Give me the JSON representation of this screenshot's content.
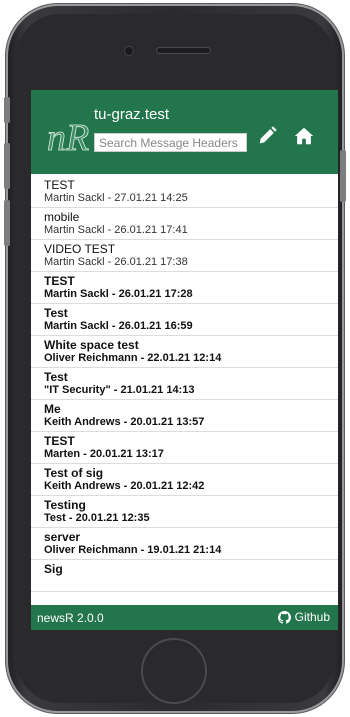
{
  "header": {
    "logo_text": "nR",
    "title": "tu-graz.test",
    "search_placeholder": "Search Message Headers",
    "edit_icon": "pencil-icon",
    "home_icon": "home-icon"
  },
  "messages": [
    {
      "subject": "TEST",
      "meta": "Martin Sackl - 27.01.21 14:25",
      "unread": false
    },
    {
      "subject": "mobile",
      "meta": "Martin Sackl - 26.01.21 17:41",
      "unread": false
    },
    {
      "subject": "VIDEO TEST",
      "meta": "Martin Sackl - 26.01.21 17:38",
      "unread": false
    },
    {
      "subject": "TEST",
      "meta": "Martin Sackl - 26.01.21 17:28",
      "unread": true
    },
    {
      "subject": "Test",
      "meta": "Martin Sackl - 26.01.21 16:59",
      "unread": true
    },
    {
      "subject": "White space test",
      "meta": "Oliver Reichmann - 22.01.21 12:14",
      "unread": true
    },
    {
      "subject": "Test",
      "meta": "\"IT Security\" - 21.01.21 14:13",
      "unread": true
    },
    {
      "subject": "Me",
      "meta": "Keith Andrews - 20.01.21 13:57",
      "unread": true
    },
    {
      "subject": "TEST",
      "meta": "Marten - 20.01.21 13:17",
      "unread": true
    },
    {
      "subject": "Test of sig",
      "meta": "Keith Andrews - 20.01.21 12:42",
      "unread": true
    },
    {
      "subject": "Testing",
      "meta": "Test - 20.01.21 12:35",
      "unread": true
    },
    {
      "subject": "server",
      "meta": "Oliver Reichmann - 19.01.21 21:14",
      "unread": true
    },
    {
      "subject": "Sig",
      "meta": "",
      "unread": true
    }
  ],
  "footer": {
    "version": "newsR 2.0.0",
    "github_label": "Github",
    "github_icon": "github-icon"
  },
  "colors": {
    "brand": "#23764b"
  }
}
